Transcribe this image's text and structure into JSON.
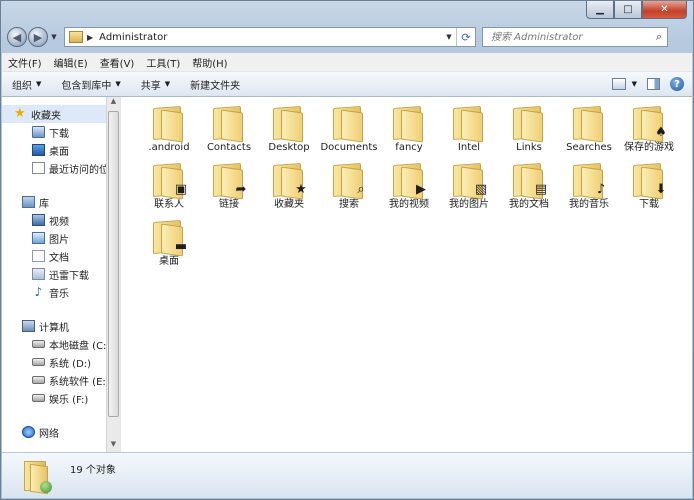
{
  "window": {
    "caption_buttons": {
      "minimize": "▁",
      "maximize": "□",
      "close": "✕"
    }
  },
  "navbar": {
    "back_glyph": "◀",
    "forward_glyph": "▶",
    "history_glyph": "▼",
    "address_separator": "▶",
    "address_path": "Administrator",
    "address_drop_glyph": "▼",
    "refresh_glyph": "⟳"
  },
  "search": {
    "placeholder": "搜索 Administrator",
    "icon_glyph": "⌕"
  },
  "menubar": {
    "items": [
      "文件(F)",
      "编辑(E)",
      "查看(V)",
      "工具(T)",
      "帮助(H)"
    ]
  },
  "toolbar": {
    "organize": "组织",
    "include_in_library": "包含到库中",
    "share": "共享",
    "new_folder": "新建文件夹",
    "caret": "▼",
    "view_caret": "▼",
    "help_glyph": "?"
  },
  "navigation": {
    "favorites": {
      "header": "收藏夹",
      "items": [
        "下载",
        "桌面",
        "最近访问的位置"
      ]
    },
    "libraries": {
      "header": "库",
      "items": [
        "视频",
        "图片",
        "文档",
        "迅雷下载",
        "音乐"
      ]
    },
    "computer": {
      "header": "计算机",
      "items": [
        "本地磁盘 (C:)",
        "系统 (D:)",
        "系统软件 (E:)",
        "娱乐 (F:)"
      ]
    },
    "network": {
      "header": "网络"
    },
    "scroll_up_glyph": "▲",
    "scroll_down_glyph": "▼",
    "star_glyph": "★",
    "music_glyph": "♪"
  },
  "files": [
    {
      "name": ".android",
      "badge": ""
    },
    {
      "name": "Contacts",
      "badge": ""
    },
    {
      "name": "Desktop",
      "badge": ""
    },
    {
      "name": "Documents",
      "badge": ""
    },
    {
      "name": "fancy",
      "badge": ""
    },
    {
      "name": "Intel",
      "badge": ""
    },
    {
      "name": "Links",
      "badge": ""
    },
    {
      "name": "Searches",
      "badge": ""
    },
    {
      "name": "保存的游戏",
      "badge": "♠"
    },
    {
      "name": "联系人",
      "badge": "▣"
    },
    {
      "name": "链接",
      "badge": "➦"
    },
    {
      "name": "收藏夹",
      "badge": "★"
    },
    {
      "name": "搜索",
      "badge": "⌕"
    },
    {
      "name": "我的视频",
      "badge": "▶"
    },
    {
      "name": "我的图片",
      "badge": "▧"
    },
    {
      "name": "我的文档",
      "badge": "▤"
    },
    {
      "name": "我的音乐",
      "badge": "♪"
    },
    {
      "name": "下载",
      "badge": "⬇"
    },
    {
      "name": "桌面",
      "badge": "▬"
    }
  ],
  "colors": {
    "accent": "#3a6fb5",
    "selected_row": "#dde9f8",
    "folder_yellow": "#efcf74"
  },
  "status": {
    "count_text": "19 个对象"
  }
}
